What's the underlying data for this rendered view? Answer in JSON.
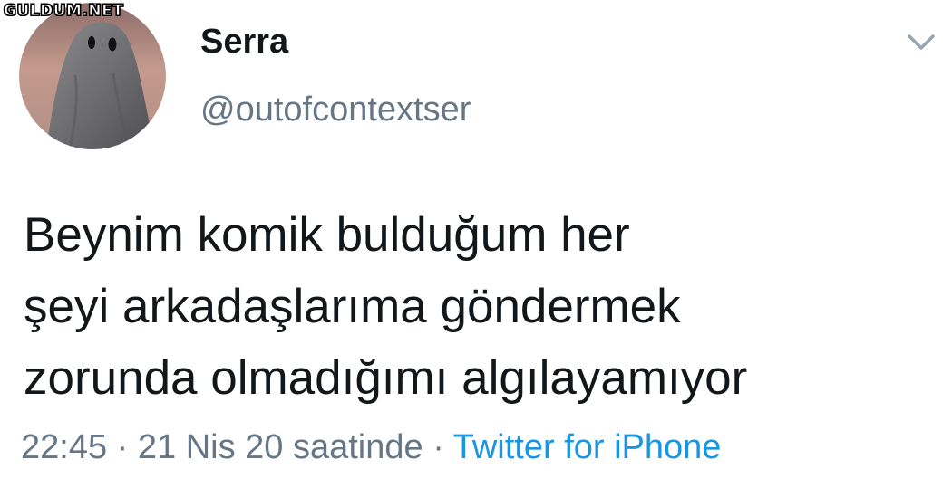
{
  "watermark": "GULDUM.NET",
  "author": {
    "display_name": "Serra",
    "handle": "@outofcontextser"
  },
  "tweet": {
    "lines": [
      "Beynim komik bulduğum her",
      "şeyi arkadaşlarıma göndermek",
      "zorunda olmadığımı algılayamıyor"
    ]
  },
  "meta": {
    "time": "22:45",
    "separator": "·",
    "date": "21 Nis 20 saatinde",
    "source": "Twitter for iPhone"
  },
  "icons": {
    "avatar": "ghost-sheet-avatar",
    "menu": "chevron-down-icon"
  },
  "colors": {
    "text": "#14171a",
    "secondary": "#657786",
    "link": "#1b95e0"
  }
}
